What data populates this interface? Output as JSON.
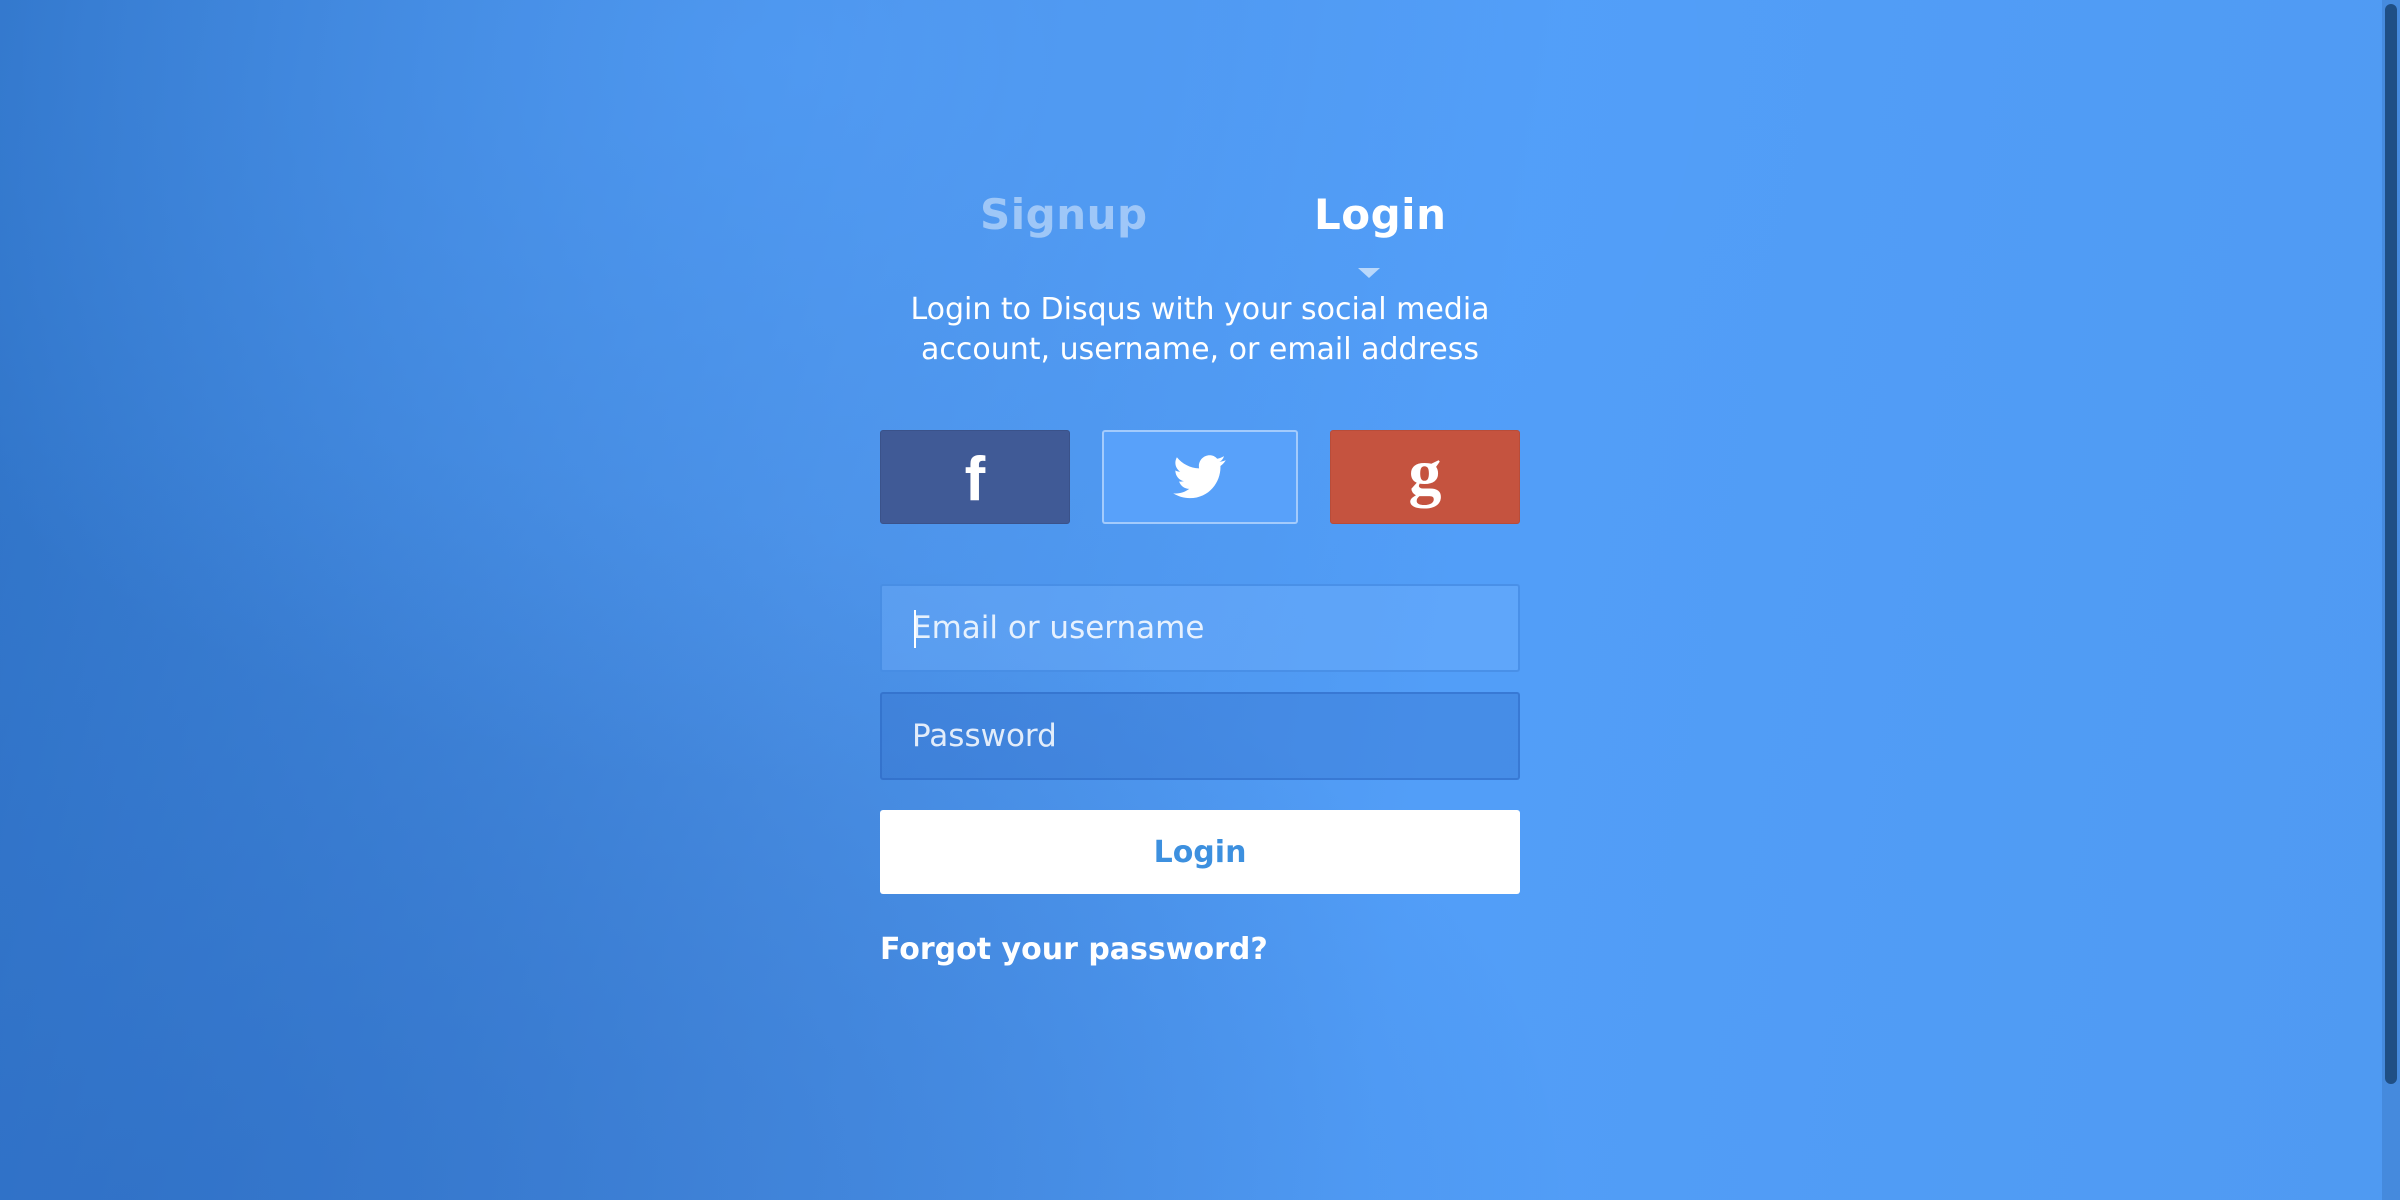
{
  "tabs": {
    "signup_label": "Signup",
    "login_label": "Login",
    "active": "Login"
  },
  "intro": {
    "line1": "Login to Disqus with your social media",
    "line2": "account, username, or email address"
  },
  "social": {
    "facebook": {
      "icon": "facebook-icon",
      "glyph": "f",
      "color": "#405a96"
    },
    "twitter": {
      "icon": "twitter-icon",
      "color": "#58a1fa"
    },
    "google": {
      "icon": "google-icon",
      "glyph": "g",
      "color": "#c5533f"
    }
  },
  "form": {
    "email_placeholder": "Email or username",
    "password_placeholder": "Password",
    "login_button": "Login",
    "forgot_link": "Forgot your password?"
  },
  "colors": {
    "background": "#4f9af2",
    "login_button_text": "#3d90df"
  }
}
